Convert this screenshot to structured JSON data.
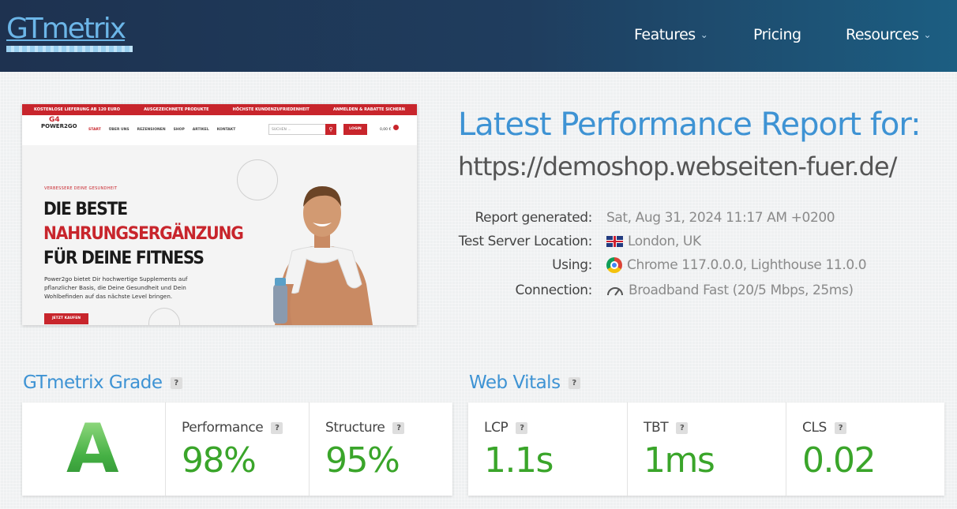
{
  "header": {
    "logo": "GTmetrix",
    "nav": [
      {
        "label": "Features",
        "has_dropdown": true
      },
      {
        "label": "Pricing",
        "has_dropdown": false
      },
      {
        "label": "Resources",
        "has_dropdown": true
      }
    ]
  },
  "screenshot": {
    "topbar": [
      "KOSTENLOSE LIEFERUNG AB 120 EURO",
      "AUSGEZEICHNETE PRODUKTE",
      "HÖCHSTE KUNDENZUFRIEDENHEIT",
      "ANMELDEN & RABATTE SICHERN"
    ],
    "brand": "POWER2GO",
    "brand_mark": "G4",
    "menu": [
      "START",
      "ÜBER UNS",
      "REZENSIONEN",
      "SHOP",
      "ARTIKEL",
      "KONTAKT"
    ],
    "search_placeholder": "SUCHEN ...",
    "login": "LOGIN",
    "cart": "0,00 €",
    "kicker": "VERBESSERE DEINE GESUNDHEIT",
    "headline_1": "DIE BESTE",
    "headline_2": "NAHRUNGSERGÄNZUNG",
    "headline_3": "FÜR DEINE FITNESS",
    "paragraph": "Power2go bietet Dir hochwertige Supplements auf pflanzlicher Basis, die Deine Gesundheit und Dein Wohlbefinden auf das nächste Level bringen.",
    "cta": "JETZT KAUFEN"
  },
  "report": {
    "title": "Latest Performance Report for:",
    "url": "https://demoshop.webseiten-fuer.de/",
    "meta": [
      {
        "key": "Report generated:",
        "value": "Sat, Aug 31, 2024 11:17 AM +0200",
        "icon": ""
      },
      {
        "key": "Test Server Location:",
        "value": "London, UK",
        "icon": "uk-flag-icon"
      },
      {
        "key": "Using:",
        "value": "Chrome 117.0.0.0, Lighthouse 11.0.0",
        "icon": "chrome-icon"
      },
      {
        "key": "Connection:",
        "value": "Broadband Fast (20/5 Mbps, 25ms)",
        "icon": "speed-gauge-icon"
      }
    ]
  },
  "grade_section": {
    "heading": "GTmetrix Grade",
    "grade": "A",
    "performance_label": "Performance",
    "performance_value": "98%",
    "structure_label": "Structure",
    "structure_value": "95%"
  },
  "vitals_section": {
    "heading": "Web Vitals",
    "lcp_label": "LCP",
    "lcp_value": "1.1s",
    "tbt_label": "TBT",
    "tbt_value": "1ms",
    "cls_label": "CLS",
    "cls_value": "0.02"
  },
  "help_glyph": "?",
  "colors": {
    "accent_blue": "#3e93d4",
    "grade_green": "#44b046",
    "value_green": "#3aa52a",
    "brand_red": "#c8252c"
  }
}
